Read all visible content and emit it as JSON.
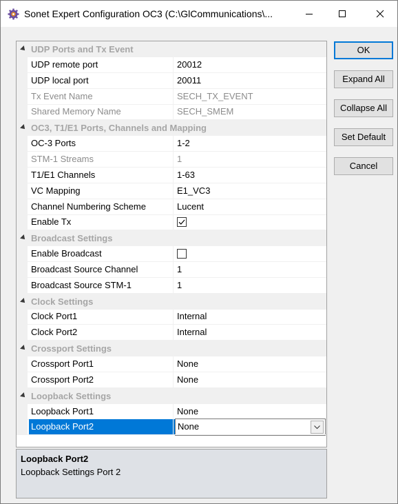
{
  "window": {
    "title": "Sonet Expert Configuration OC3 (C:\\GlCommunications\\..."
  },
  "buttons": {
    "ok": "OK",
    "expand_all": "Expand All",
    "collapse_all": "Collapse All",
    "set_default": "Set Default",
    "cancel": "Cancel"
  },
  "grid": {
    "categories": [
      {
        "label": "UDP Ports and Tx Event",
        "properties": [
          {
            "name": "UDP remote port",
            "value": "20012",
            "readonly": false
          },
          {
            "name": "UDP local port",
            "value": "20011",
            "readonly": false
          },
          {
            "name": "Tx Event Name",
            "value": "SECH_TX_EVENT",
            "readonly": true
          },
          {
            "name": "Shared Memory Name",
            "value": "SECH_SMEM",
            "readonly": true
          }
        ]
      },
      {
        "label": "OC3, T1/E1 Ports, Channels and Mapping",
        "properties": [
          {
            "name": "OC-3 Ports",
            "value": "1-2",
            "readonly": false
          },
          {
            "name": "STM-1 Streams",
            "value": "1",
            "readonly": true
          },
          {
            "name": "T1/E1 Channels",
            "value": "1-63",
            "readonly": false
          },
          {
            "name": "VC Mapping",
            "value": "E1_VC3",
            "readonly": false
          },
          {
            "name": "Channel Numbering Scheme",
            "value": "Lucent",
            "readonly": false
          },
          {
            "name": "Enable Tx",
            "checkbox": true,
            "checked": true,
            "readonly": false
          }
        ]
      },
      {
        "label": "Broadcast Settings",
        "properties": [
          {
            "name": "Enable Broadcast",
            "checkbox": true,
            "checked": false,
            "readonly": false
          },
          {
            "name": "Broadcast Source Channel",
            "value": "1",
            "readonly": false
          },
          {
            "name": "Broadcast Source STM-1",
            "value": "1",
            "readonly": false
          }
        ]
      },
      {
        "label": "Clock Settings",
        "properties": [
          {
            "name": "Clock Port1",
            "value": "Internal",
            "readonly": false
          },
          {
            "name": "Clock Port2",
            "value": "Internal",
            "readonly": false
          }
        ]
      },
      {
        "label": "Crossport Settings",
        "properties": [
          {
            "name": "Crossport Port1",
            "value": "None",
            "readonly": false
          },
          {
            "name": "Crossport Port2",
            "value": "None",
            "readonly": false
          }
        ]
      },
      {
        "label": "Loopback Settings",
        "properties": [
          {
            "name": "Loopback Port1",
            "value": "None",
            "readonly": false
          },
          {
            "name": "Loopback Port2",
            "value": "None",
            "readonly": false,
            "selected": true,
            "dropdown": true
          }
        ]
      }
    ]
  },
  "help": {
    "title": "Loopback Port2",
    "description": "Loopback Settings Port 2"
  },
  "colors": {
    "selection": "#0078d7",
    "category_text": "#a6a6a6",
    "readonly_text": "#8c8c8c"
  }
}
